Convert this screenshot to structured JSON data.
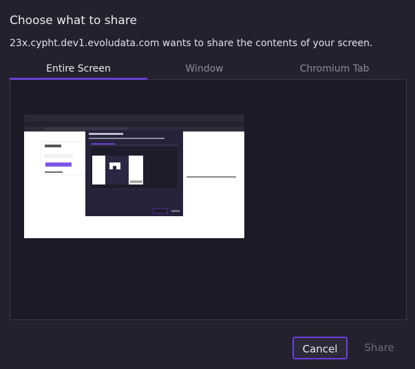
{
  "dialog": {
    "title": "Choose what to share",
    "subtitle": "23x.cypht.dev1.evoludata.com wants to share the contents of your screen."
  },
  "tabs": [
    {
      "label": "Entire Screen",
      "active": true
    },
    {
      "label": "Window",
      "active": false
    },
    {
      "label": "Chromium Tab",
      "active": false
    }
  ],
  "colors": {
    "accent": "#6b3fd4",
    "background": "#23212e",
    "panel": "#1c1a26"
  },
  "buttons": {
    "cancel_label": "Cancel",
    "share_label": "Share"
  }
}
